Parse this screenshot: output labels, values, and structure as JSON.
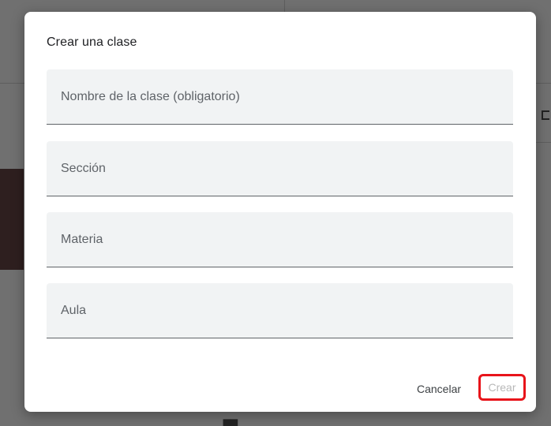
{
  "dialog": {
    "title": "Crear una clase",
    "fields": [
      {
        "placeholder": "Nombre de la clase (obligatorio)",
        "value": ""
      },
      {
        "placeholder": "Sección",
        "value": ""
      },
      {
        "placeholder": "Materia",
        "value": ""
      },
      {
        "placeholder": "Aula",
        "value": ""
      }
    ],
    "cancel_label": "Cancelar",
    "create_label": "Crear"
  },
  "colors": {
    "overlay": "#707070",
    "field_background": "#f1f3f4",
    "highlight": "#e8141a",
    "disabled_text": "#b8b8b8"
  }
}
